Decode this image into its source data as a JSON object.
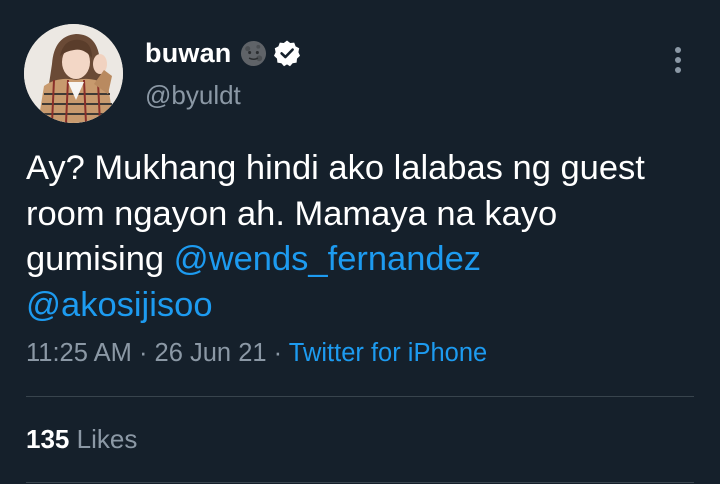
{
  "user": {
    "display_name": "buwan",
    "handle": "@byuldt",
    "name_emoji": "new-moon-face-emoji",
    "verified_icon": "verified-badge-icon"
  },
  "tweet": {
    "text_line1": "Ay? Mukhang hindi ako lalabas ng guest",
    "text_line2": "room ngayon ah. Mamaya na kayo",
    "text_line3_prefix": "gumising",
    "mention1": "@wends_fernandez",
    "mention2": "@akosijisoo"
  },
  "meta": {
    "time": "11:25 AM",
    "sep1": "·",
    "date": "26 Jun 21",
    "sep2": "·",
    "source": "Twitter for iPhone"
  },
  "stats": {
    "likes_count": "135",
    "likes_label": "Likes"
  },
  "colors": {
    "background": "#15202b",
    "link": "#1d9bf0",
    "secondary_text": "#8b98a5",
    "divider": "#38444d"
  },
  "icons": {
    "more": "more-vertical-icon"
  }
}
